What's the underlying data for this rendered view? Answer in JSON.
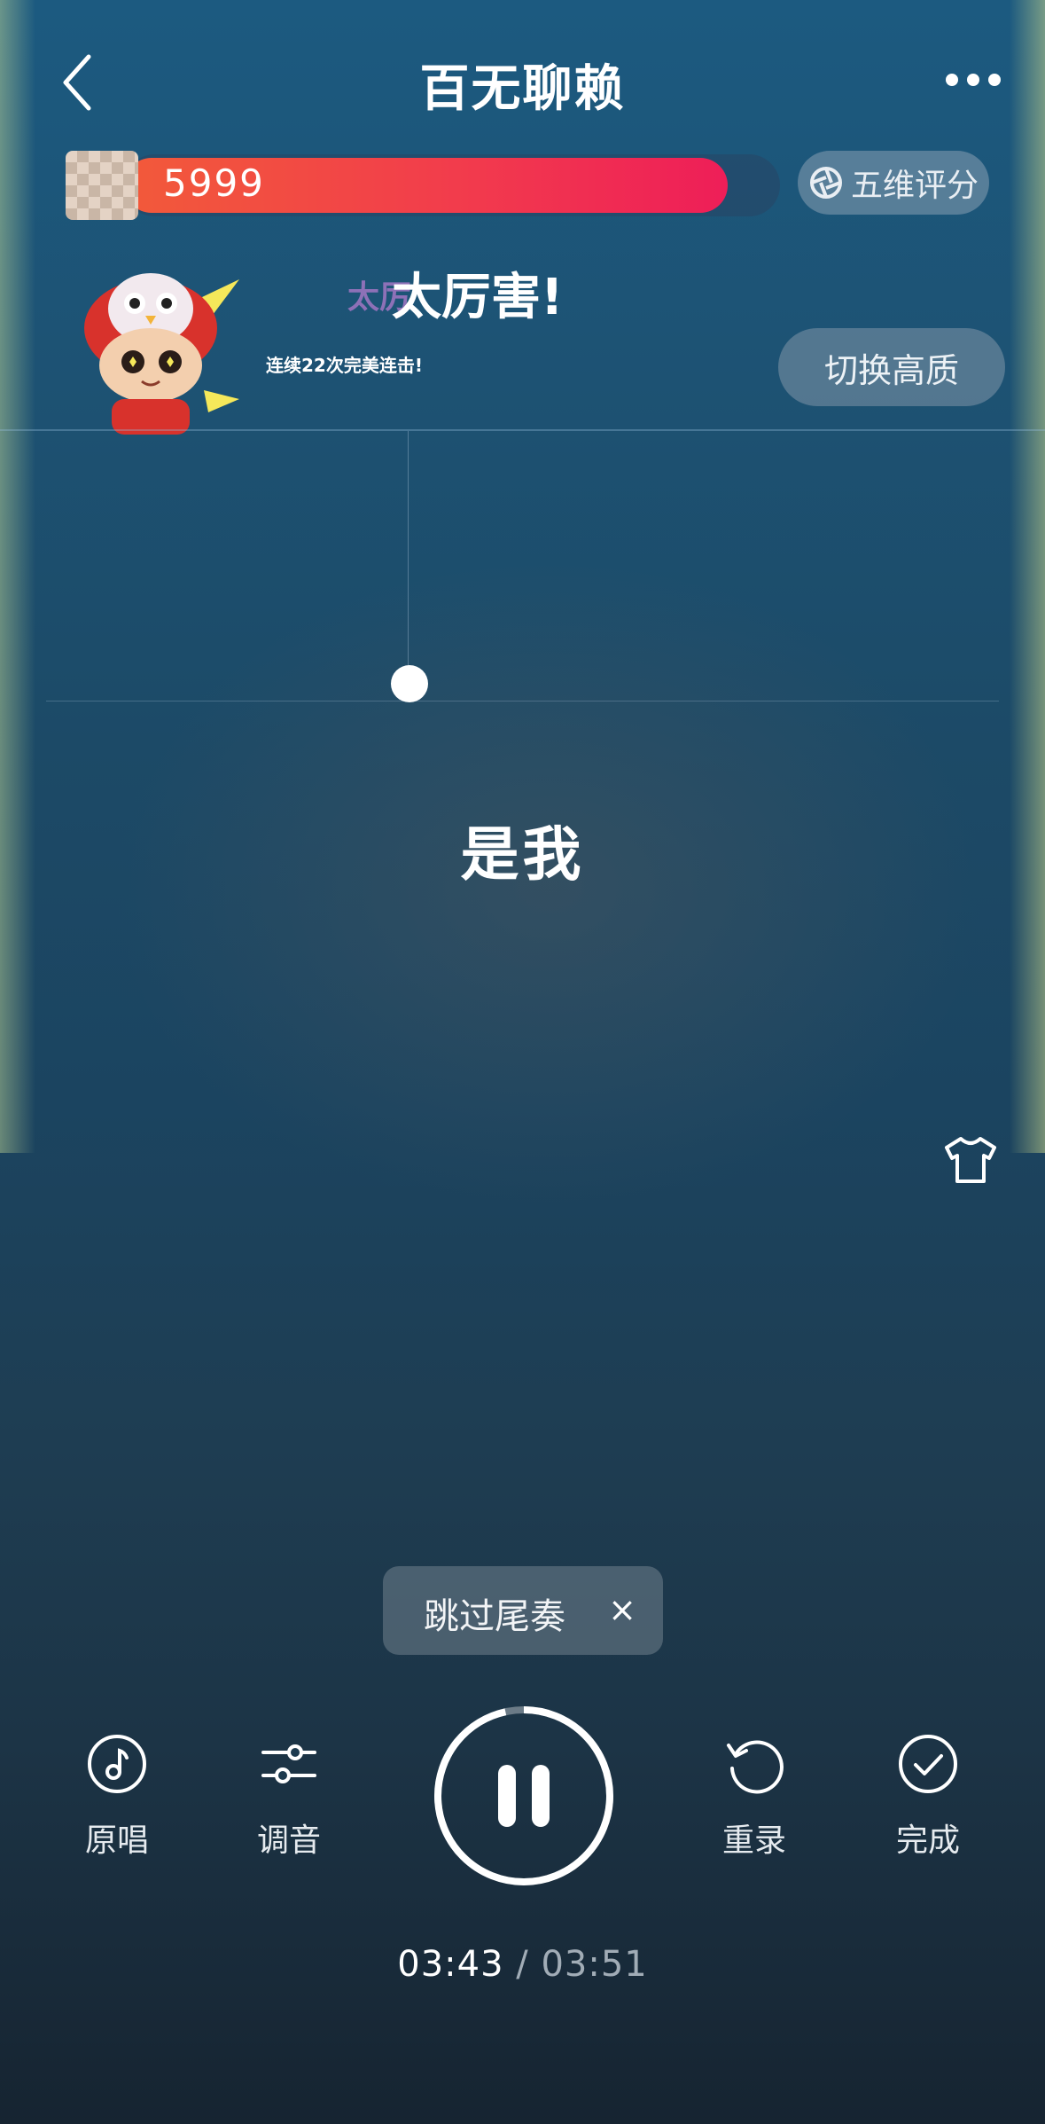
{
  "header": {
    "title": "百无聊赖",
    "back_icon": "chevron-left-icon",
    "more_icon": "more-dots-icon"
  },
  "score": {
    "value": "5999",
    "progress": 0.92,
    "rating_label": "五维评分"
  },
  "combo": {
    "title": "太厉害!",
    "ghost": "太厉",
    "subtitle": "连续22次完美连击!"
  },
  "quality_button": "切换高质",
  "lyrics": {
    "current": "是我"
  },
  "skip": {
    "label": "跳过尾奏",
    "close": "×"
  },
  "controls": {
    "original": "原唱",
    "tuning": "调音",
    "rerecord": "重录",
    "done": "完成"
  },
  "playback": {
    "current": "03:43",
    "separator": "/",
    "total": "03:51",
    "state": "playing"
  },
  "colors": {
    "accent": "#ee1e58",
    "bg_top": "#1c5a80",
    "bg_bottom": "#162431"
  }
}
